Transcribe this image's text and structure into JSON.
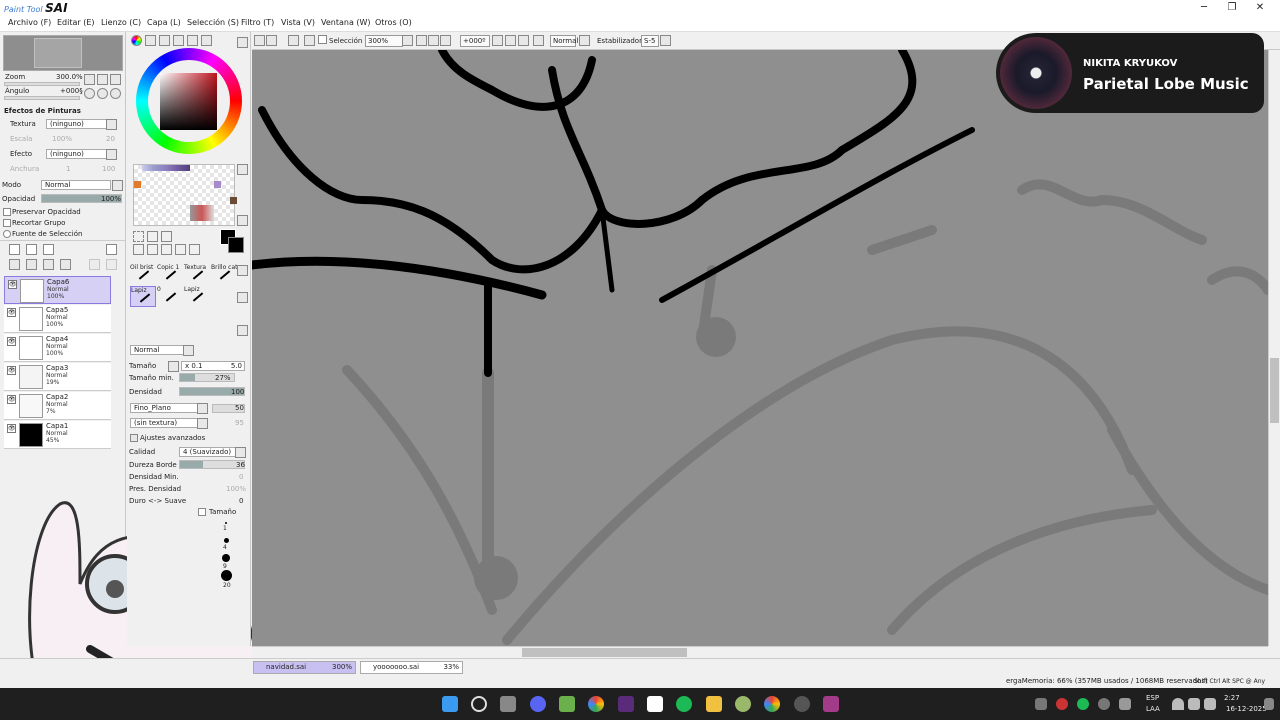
{
  "app": {
    "logo_small": "Paint Tool",
    "logo_big": "SAI"
  },
  "menu": [
    "Archivo (F)",
    "Editar (E)",
    "Lienzo (C)",
    "Capa (L)",
    "Selección (S)",
    "Filtro (T)",
    "Vista (V)",
    "Ventana (W)",
    "Otros (O)"
  ],
  "toolbar": {
    "selection_label": "Selección",
    "zoom": "300%",
    "rotation": "+000º",
    "blend_mode": "Normal",
    "stabilizer_label": "Estabilizador",
    "stabilizer_value": "S-5"
  },
  "navigator": {
    "zoom_label": "Zoom",
    "zoom_value": "300.0%",
    "angle_label": "Ángulo",
    "angle_value": "+000§"
  },
  "paint_effects": {
    "header": "Efectos de Pinturas",
    "texture_label": "Textura",
    "texture_value": "(ninguno)",
    "texture_sub1": "Escala",
    "texture_sub1_val": "100%",
    "texture_sub2_val": "20",
    "effect_label": "Efecto",
    "effect_value": "(ninguno)",
    "effect_sub1": "Anchura",
    "effect_sub1_val": "1",
    "effect_sub2_val": "100"
  },
  "layer_props": {
    "mode_label": "Modo",
    "mode_value": "Normal",
    "opacity_label": "Opacidad",
    "opacity_value": "100%",
    "opacity_fraction": 1.0,
    "checks": [
      "Preservar Opacidad",
      "Recortar Grupo",
      "Fuente de Selección"
    ]
  },
  "layers": [
    {
      "name": "Capa6",
      "mode": "Normal",
      "opacity": "100%",
      "selected": true,
      "thumb": "#ffffff"
    },
    {
      "name": "Capa5",
      "mode": "Normal",
      "opacity": "100%",
      "selected": false,
      "thumb": "#ffffff"
    },
    {
      "name": "Capa4",
      "mode": "Normal",
      "opacity": "100%",
      "selected": false,
      "thumb": "#ffffff"
    },
    {
      "name": "Capa3",
      "mode": "Normal",
      "opacity": "19%",
      "selected": false,
      "thumb": "#f4f4f4"
    },
    {
      "name": "Capa2",
      "mode": "Normal",
      "opacity": "7%",
      "selected": false,
      "thumb": "#f8f8f8"
    },
    {
      "name": "Capa1",
      "mode": "Normal",
      "opacity": "45%",
      "selected": false,
      "thumb": "#000000"
    }
  ],
  "brush_tools": {
    "row1": [
      "Oil brist",
      "Copic 1",
      "Textura",
      "Brillo cat"
    ],
    "row2": [
      "Lapiz",
      "0",
      "Lapiz",
      ""
    ]
  },
  "brush_settings": {
    "mode": "Normal",
    "size_label": "Tamaño",
    "size_mult": "x 0.1",
    "size_value": "5.0",
    "min_size_label": "Tamaño min.",
    "min_size_value": "27%",
    "min_size_fraction": 0.27,
    "density_label": "Densidad",
    "density_value": "100",
    "density_fraction": 1.0,
    "shape": "Fino_Plano",
    "shape_value": "50",
    "texture": "(sin textura)",
    "texture_value": "95",
    "advanced_label": "Ajustes avanzados",
    "quality_label": "Calidad",
    "quality_value": "4 (Suavizado)",
    "edge_label": "Dureza Borde",
    "edge_value": "36",
    "edge_fraction": 0.36,
    "min_density_label": "Densidad Min.",
    "min_density_value": "0",
    "pressure_label": "Pres. Densidad",
    "pressure_value": "100%",
    "hard_soft_label": "Duro <-> Suave",
    "hard_soft_value": "0",
    "size_check": "Tamaño",
    "dot_sizes": [
      "1",
      "4",
      "9",
      "20"
    ]
  },
  "now_playing": {
    "artist": "NIKITA KRYUKOV",
    "title": "Parietal Lobe Music"
  },
  "doc_tabs": [
    {
      "name": "navidad.sai",
      "zoom": "300%",
      "active": true
    },
    {
      "name": "yooooooo.sai",
      "zoom": "33%",
      "active": false
    }
  ],
  "status": {
    "memory": "ergaMemoria: 66% (357MB usados / 1068MB reservados)",
    "keys": "Shift Ctrl Alt SPC @ Any"
  },
  "taskbar": {
    "lang": "ESP",
    "lang2": "LAA",
    "time": "2:27",
    "date": "16-12-2025"
  },
  "colors": {
    "accent": "#8a7be0",
    "canvas": "#8f8f8f",
    "taskbar": "#1f1f1f"
  }
}
